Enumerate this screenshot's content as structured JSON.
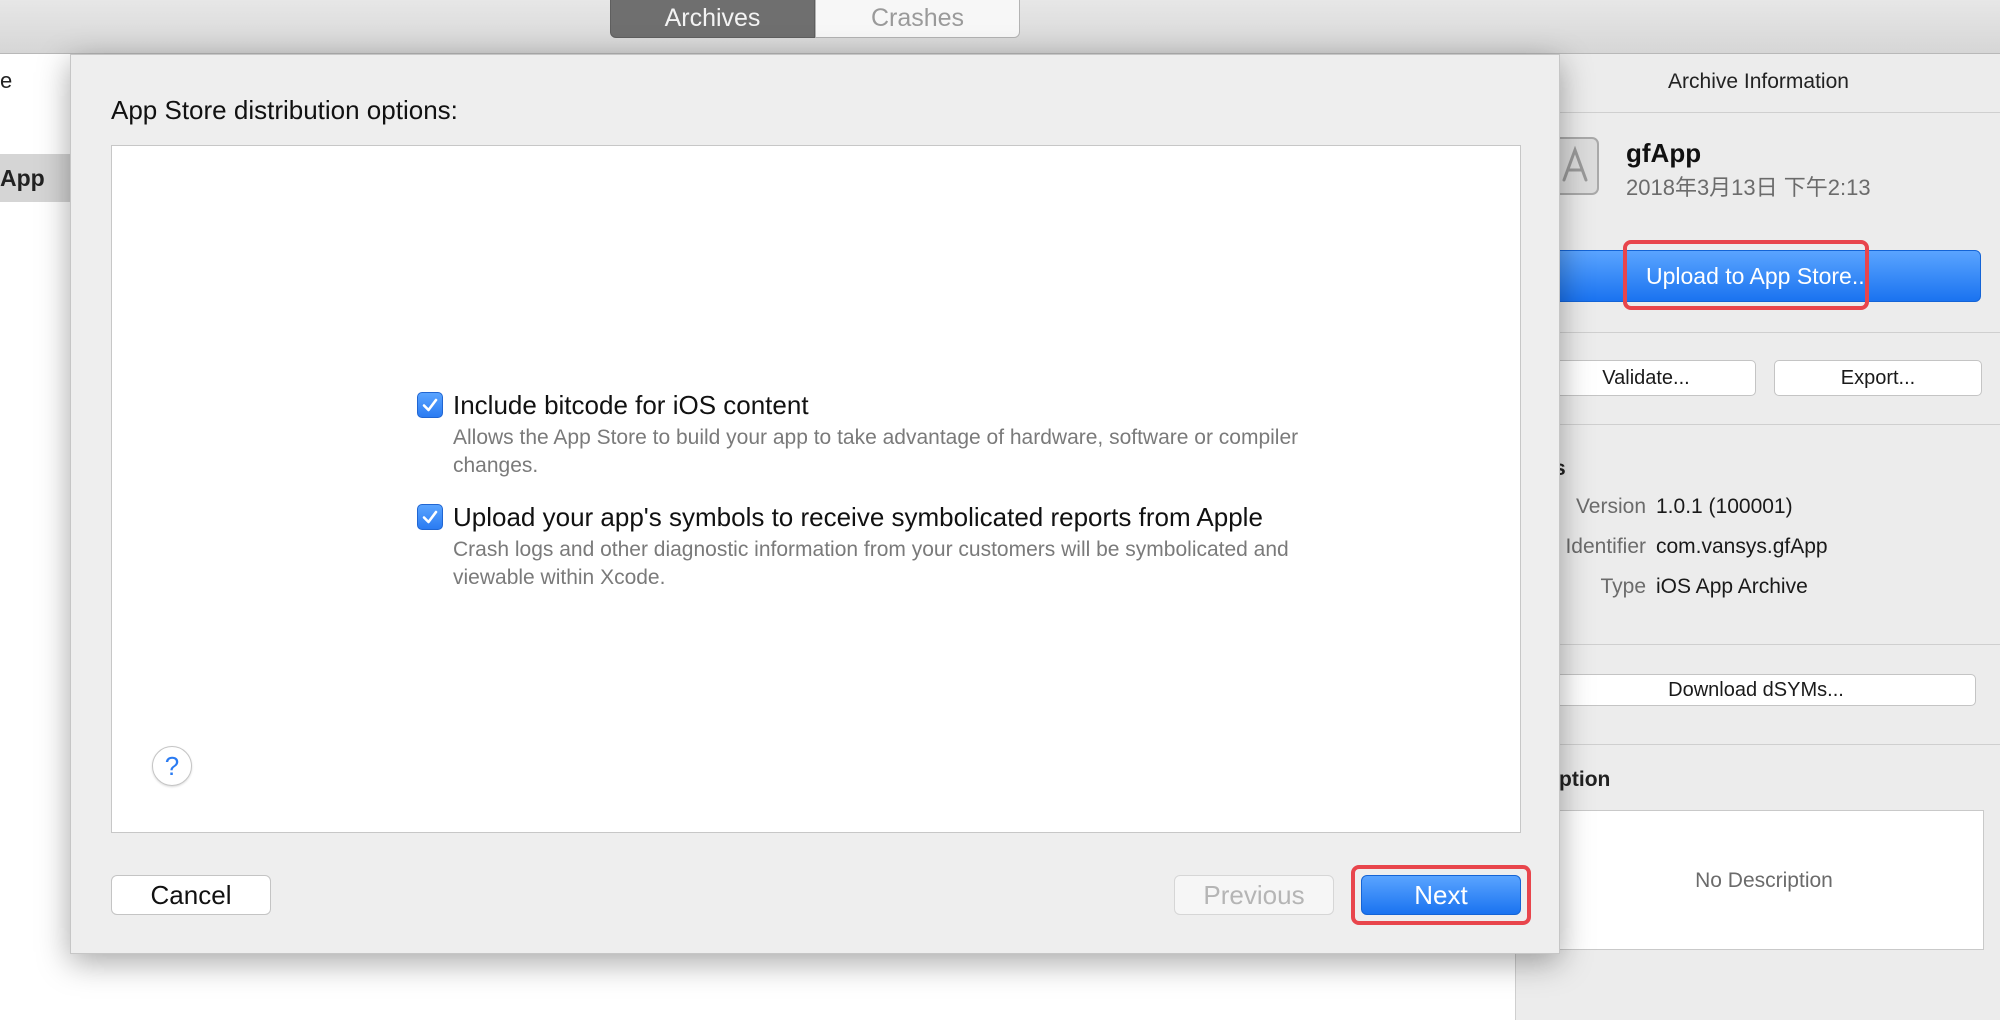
{
  "toolbar": {
    "tabs": [
      {
        "label": "Archives",
        "selected": true
      },
      {
        "label": "Crashes",
        "selected": false
      }
    ]
  },
  "left_list": {
    "row1_text": "e",
    "row2_text": "App"
  },
  "inspector": {
    "title": "Archive Information",
    "app_name": "gfApp",
    "app_date": "2018年3月13日 下午2:13",
    "upload_label": "Upload to App Store...",
    "validate_label": "Validate...",
    "export_label": "Export...",
    "details_heading": "etails",
    "details": [
      {
        "key": "Version",
        "value": "1.0.1 (100001)"
      },
      {
        "key": "Identifier",
        "value": "com.vansys.gfApp"
      },
      {
        "key": "Type",
        "value": "iOS App Archive"
      }
    ],
    "download_label": "Download dSYMs...",
    "description_heading": "escription",
    "description_text": "No Description"
  },
  "sheet": {
    "title": "App Store distribution options:",
    "options": [
      {
        "label": "Include bitcode for iOS content",
        "description": "Allows the App Store to build your app to take advantage of hardware, software or compiler changes.",
        "checked": true
      },
      {
        "label": "Upload your app's symbols to receive symbolicated reports from Apple",
        "description": "Crash logs and other diagnostic information from your customers will be symbolicated and viewable within Xcode.",
        "checked": true
      }
    ],
    "help_label": "?",
    "cancel_label": "Cancel",
    "previous_label": "Previous",
    "next_label": "Next"
  },
  "colors": {
    "accent": "#1a73f0",
    "highlight": "#e8454c"
  }
}
